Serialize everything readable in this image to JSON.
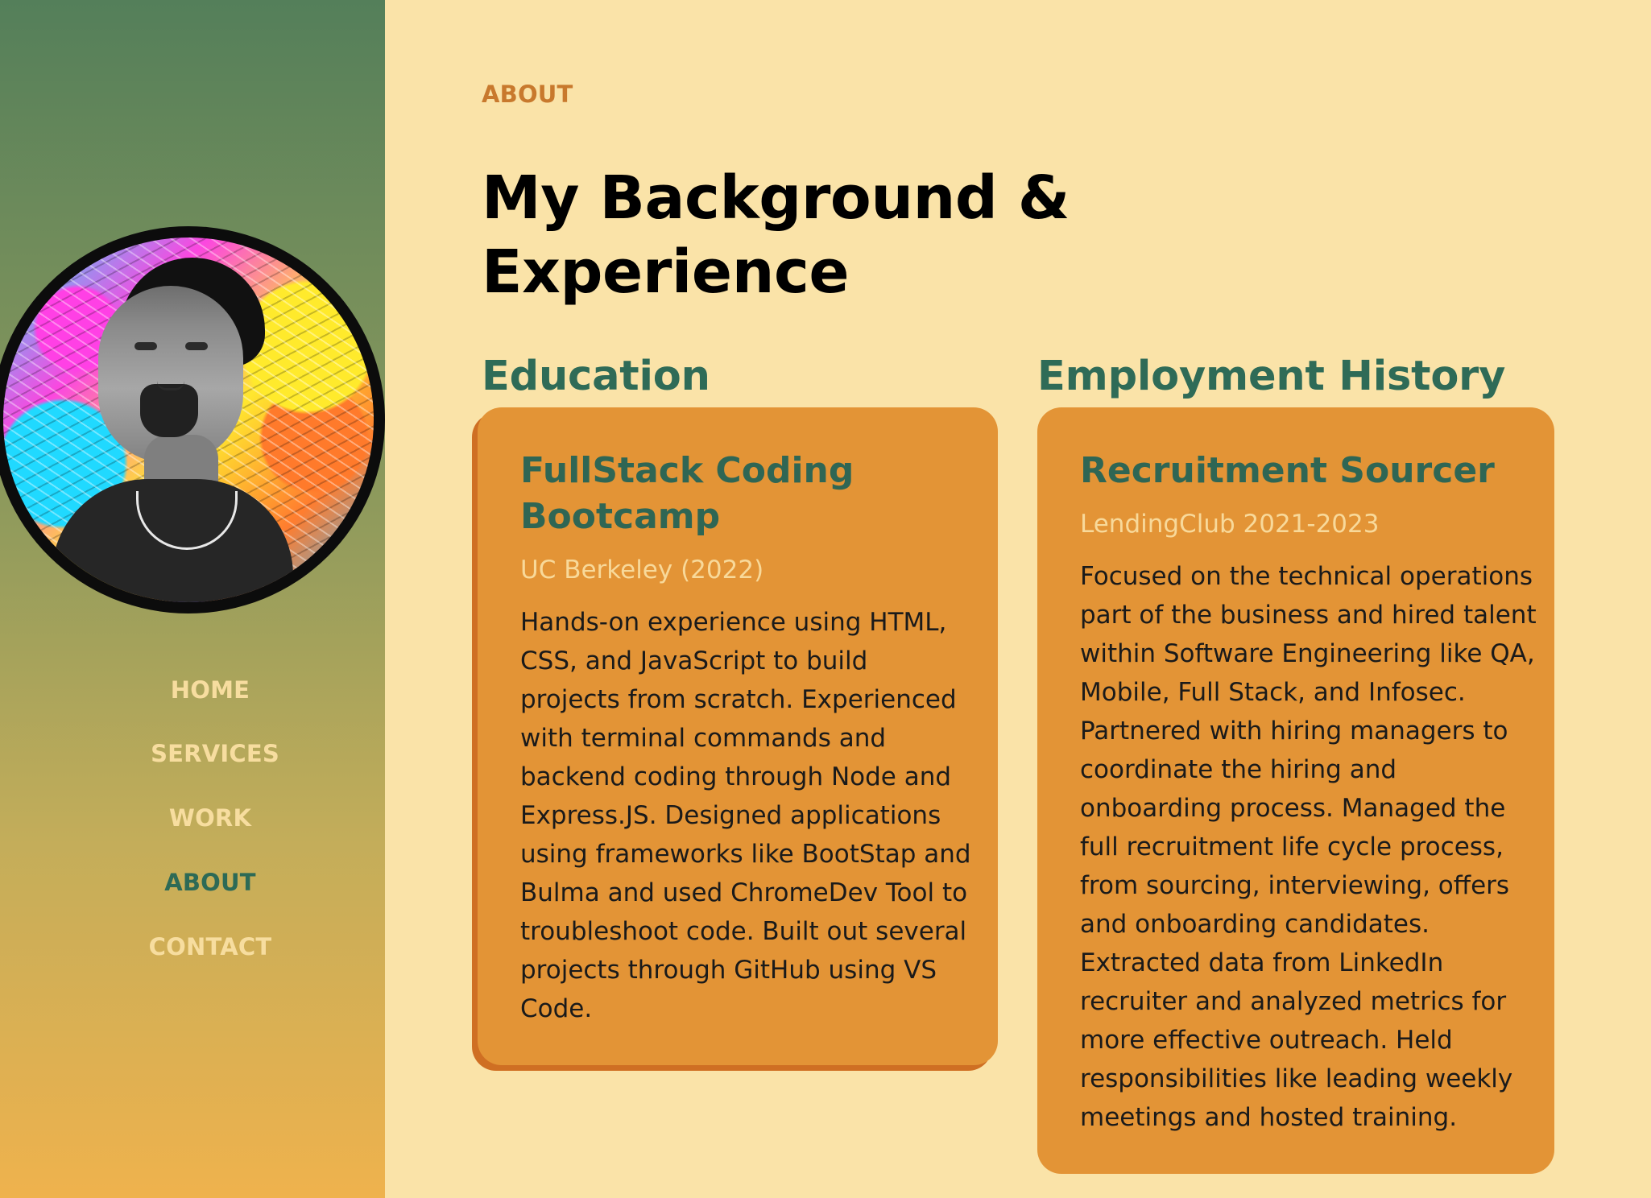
{
  "sidebar": {
    "nav": {
      "home": "HOME",
      "services": "SERVICES",
      "work": "WORK",
      "about": "ABOUT",
      "contact": "CONTACT"
    }
  },
  "main": {
    "eyebrow": "ABOUT",
    "title": "My Background & Experience",
    "education": {
      "heading": "Education",
      "card": {
        "title": "FullStack Coding Bootcamp",
        "subtitle": "UC Berkeley (2022)",
        "body": "Hands-on experience using HTML, CSS, and JavaScript to build projects from scratch. Experienced with terminal commands and backend coding through Node and Express.JS. Designed applications using frameworks like BootStap and Bulma and used ChromeDev Tool to troubleshoot code. Built out several projects through GitHub using VS Code."
      }
    },
    "employment": {
      "heading": "Employment History",
      "card": {
        "title": "Recruitment Sourcer",
        "subtitle": "LendingClub 2021-2023",
        "body": "Focused on the technical operations part of the business and hired talent within Software Engineering like QA, Mobile, Full Stack, and Infosec. Partnered with hiring managers to coordinate the hiring and onboarding process. Managed the full recruitment life cycle process, from sourcing, interviewing, offers and onboarding candidates. Extracted data from LinkedIn recruiter and analyzed metrics for more effective outreach. Held responsibilities like leading weekly meetings and hosted training."
      }
    }
  },
  "colors": {
    "page_background": "#fae3a8",
    "sidebar_top": "#547f5a",
    "sidebar_bottom": "#efb24d",
    "accent_orange": "#c8792d",
    "card_orange": "#e39436",
    "heading_green": "#2f6b57",
    "nav_inactive": "#f7dd9f",
    "nav_active": "#2d6a56"
  }
}
